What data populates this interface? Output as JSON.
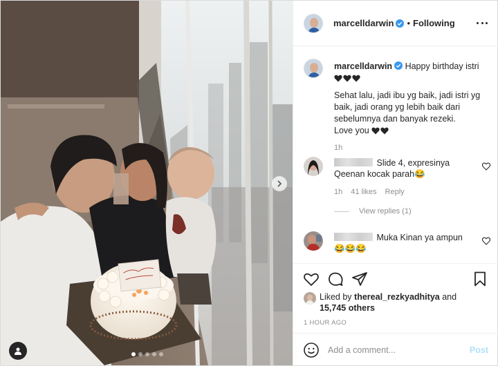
{
  "post": {
    "author": "marcelldarwin",
    "follow_status": "Following",
    "separator": "•",
    "verified": true
  },
  "caption": {
    "username": "marcelldarwin",
    "text_intro": "Happy birthday istri",
    "text_body": "Sehat lalu, jadi ibu yg baik, jadi istri yg baik, jadi orang yg lebih baik dari sebelumnya dan banyak rezeki.",
    "text_end": "Love you",
    "time": "1h"
  },
  "comments": [
    {
      "text": "Slide 4, expresinya Qeenan kocak parah😂",
      "time": "1h",
      "likes": "41 likes",
      "reply": "Reply",
      "view_replies": "View replies (1)"
    },
    {
      "text": "Muka Kinan ya ampun 😂😂😂"
    }
  ],
  "likes": {
    "prefix": "Liked by",
    "user": "thereal_rezkyadhitya",
    "and": "and",
    "others": "15,745 others"
  },
  "posted_ago": "1 HOUR AGO",
  "add_comment": {
    "placeholder": "Add a comment...",
    "post_label": "Post"
  },
  "carousel": {
    "slides": 5,
    "active": 0
  },
  "colors": {
    "verified": "#3897f0",
    "post_disabled": "#b2dffc",
    "muted": "#8e8e8e",
    "text": "#262626",
    "border": "#efefef"
  },
  "icons": [
    "more-options-icon",
    "heart-icon",
    "comment-icon",
    "share-icon",
    "bookmark-icon",
    "emoji-icon",
    "chevron-right-icon",
    "user-tag-icon",
    "verified-badge-icon"
  ]
}
